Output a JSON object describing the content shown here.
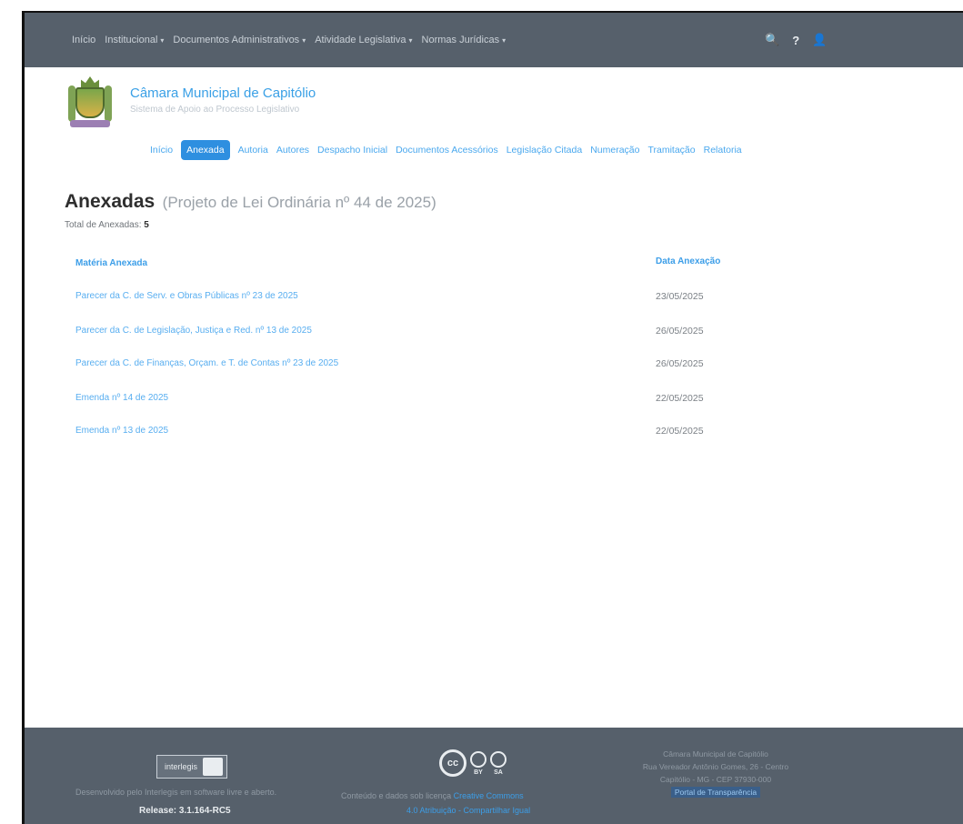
{
  "navbar": {
    "items": [
      {
        "label": "Início"
      },
      {
        "label": "Institucional"
      },
      {
        "label": "Documentos Administrativos"
      },
      {
        "label": "Atividade Legislativa"
      },
      {
        "label": "Normas Jurídicas"
      }
    ],
    "tools": {
      "search": "🔍",
      "help": "?",
      "user": "👤"
    }
  },
  "header": {
    "name": "Câmara Municipal de Capitólio",
    "subtitle": "Sistema de Apoio ao Processo Legislativo"
  },
  "tabs": [
    {
      "label": "Início",
      "active": false
    },
    {
      "label": "Anexada",
      "active": true
    },
    {
      "label": "Autoria",
      "active": false
    },
    {
      "label": "Autores",
      "active": false
    },
    {
      "label": "Despacho Inicial",
      "active": false
    },
    {
      "label": "Documentos Acessórios",
      "active": false
    },
    {
      "label": "Legislação Citada",
      "active": false
    },
    {
      "label": "Numeração",
      "active": false
    },
    {
      "label": "Tramitação",
      "active": false
    },
    {
      "label": "Relatoria",
      "active": false
    }
  ],
  "page": {
    "title": "Anexadas",
    "subtitle": "(Projeto de Lei Ordinária nº 44 de 2025)",
    "total_label": "Total de Anexadas:",
    "total_value": "5"
  },
  "table": {
    "headers": [
      "Matéria Anexada",
      "Data Anexação"
    ],
    "rows": [
      {
        "materia": "Parecer da C. de Serv. e Obras Públicas nº 23 de 2025",
        "data": "23/05/2025"
      },
      {
        "materia": "Parecer da C. de Legislação, Justiça e Red. nº 13 de 2025",
        "data": "26/05/2025"
      },
      {
        "materia": "Parecer da C. de Finanças, Orçam. e T. de Contas nº 23 de 2025",
        "data": "26/05/2025"
      },
      {
        "materia": "Emenda nº 14 de 2025",
        "data": "22/05/2025"
      },
      {
        "materia": "Emenda nº 13 de 2025",
        "data": "22/05/2025"
      }
    ]
  },
  "footer": {
    "logo_text": "interlegis",
    "left_text": "Desenvolvido pelo Interlegis em software livre e aberto.",
    "release": "Release: 3.1.164-RC5",
    "cc_label": "cc",
    "cc_by": "BY",
    "cc_sa": "SA",
    "mid_text": "Conteúdo e dados sob licença",
    "mid_text_link": "Creative Commons",
    "mid_link": "4.0 Atribuição - Compartilhar Igual",
    "right_line1": "Câmara Municipal de Capitólio",
    "right_line2": "Rua Vereador Antônio Gomes, 26 - Centro",
    "right_line3": "Capitólio - MG - CEP 37930-000",
    "right_link": "Portal de Transparência"
  }
}
